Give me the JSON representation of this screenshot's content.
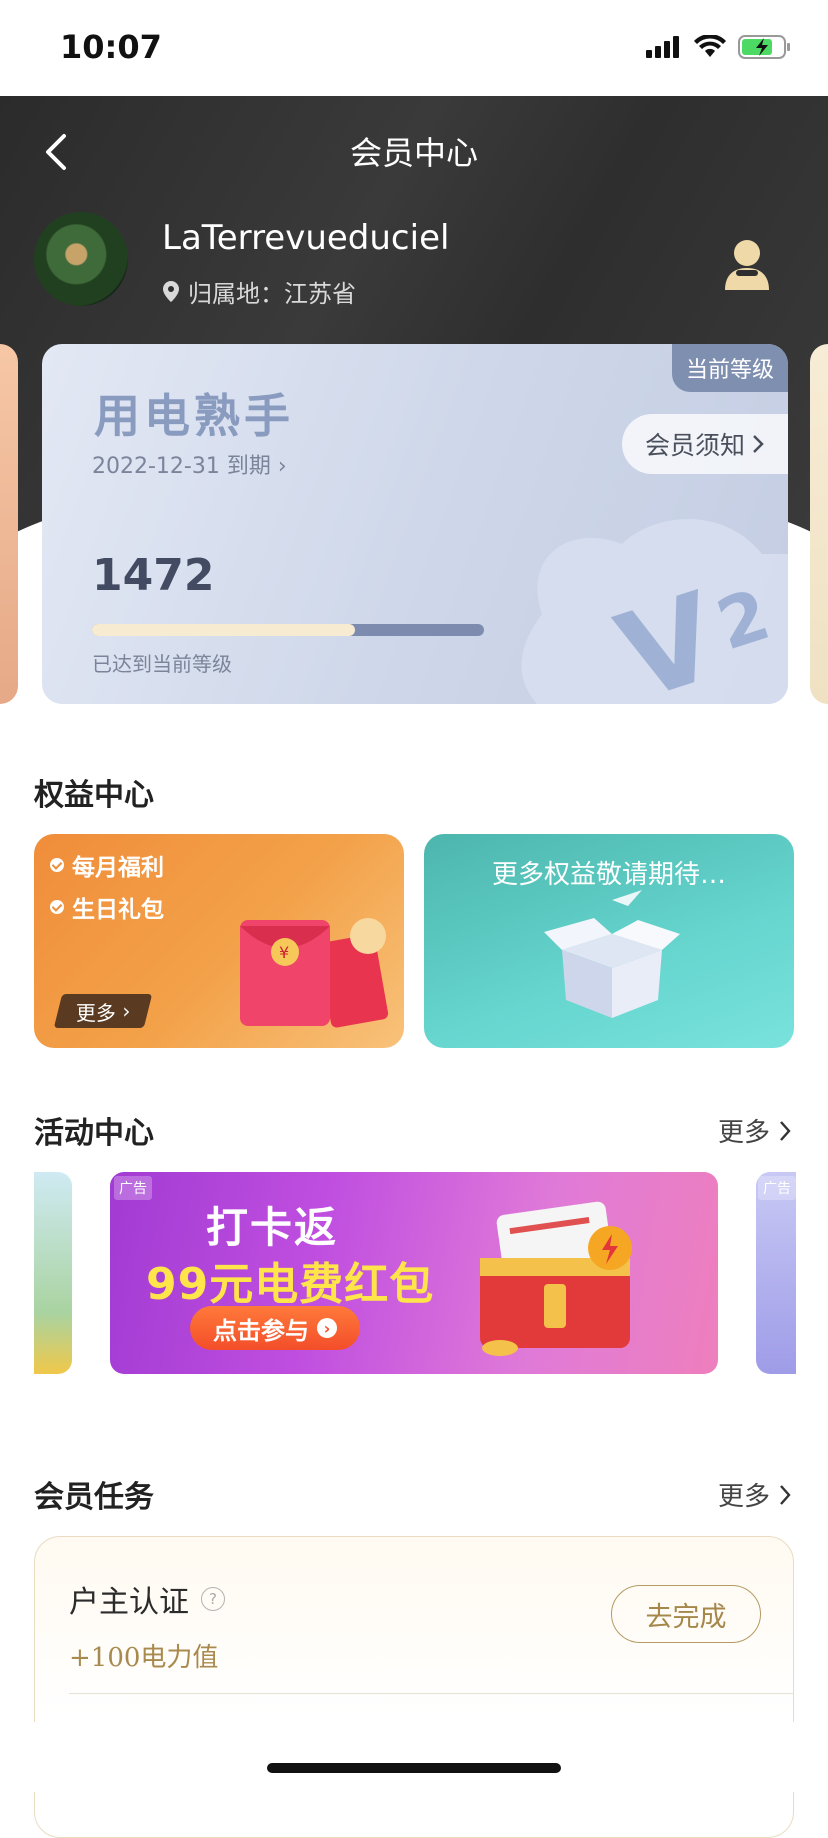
{
  "status_bar": {
    "time": "10:07"
  },
  "header": {
    "title": "会员中心"
  },
  "user": {
    "name": "LaTerrevueduciel",
    "location": "归属地：江苏省"
  },
  "level_card": {
    "badge": "当前等级",
    "level_name": "用电熟手",
    "expiry": "2022-12-31 到期",
    "notice": "会员须知",
    "points": "1472",
    "progress": 0.67,
    "status": "已达到当前等级"
  },
  "benefits": {
    "title": "权益中心",
    "card1": {
      "items": [
        "每月福利",
        "生日礼包"
      ],
      "more": "更多"
    },
    "card2": {
      "text": "更多权益敬请期待…"
    }
  },
  "activities": {
    "title": "活动中心",
    "more": "更多",
    "banner": {
      "ad": "广告",
      "line1": "打卡返",
      "line2": "99元电费红包",
      "button": "点击参与"
    },
    "right_ad": "广告"
  },
  "tasks": {
    "title": "会员任务",
    "more": "更多",
    "item": {
      "name": "户主认证",
      "reward": "+100电力值",
      "button": "去完成"
    }
  },
  "colors": {
    "header_bg": "#2e2e2e",
    "accent_gold": "#a5874b",
    "benefit_orange": "#f08d3a",
    "benefit_teal": "#4cb6ad"
  }
}
